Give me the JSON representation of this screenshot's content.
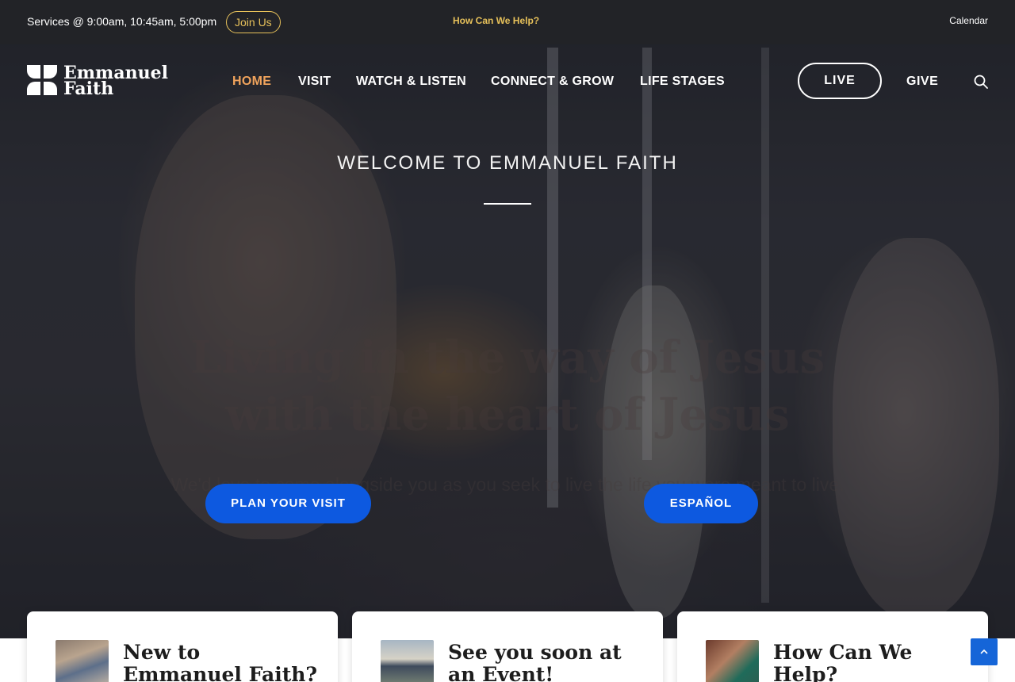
{
  "topbar": {
    "services": "Services @ 9:00am, 10:45am, 5:00pm",
    "join_label": "Join Us",
    "help_label": "How Can We Help?",
    "calendar_label": "Calendar",
    "accent_color": "#e7c15a"
  },
  "logo": {
    "line1": "Emmanuel",
    "line2": "Faith"
  },
  "nav": {
    "items": [
      {
        "label": "HOME",
        "active": true
      },
      {
        "label": "VISIT"
      },
      {
        "label": "WATCH & LISTEN"
      },
      {
        "label": "CONNECT & GROW"
      },
      {
        "label": "LIFE STAGES"
      }
    ],
    "live_label": "LIVE",
    "give_label": "GIVE",
    "search_icon": "search-icon",
    "active_color": "#f0a35c"
  },
  "hero": {
    "welcome": "WELCOME TO EMMANUEL FAITH",
    "headline_line1": "Living in the way of Jesus",
    "headline_line2": "with the heart of Jesus",
    "subline": "We'd love to come alongside you as you seek to live the life you were meant to live.",
    "plan_label": "PLAN YOUR VISIT",
    "espanol_label": "ESPAÑOL",
    "button_color": "#0d59e0"
  },
  "cards": [
    {
      "title": "New to Emmanuel Faith? Start here!"
    },
    {
      "title": "See you soon at an Event!"
    },
    {
      "title": "How Can We Help?"
    }
  ],
  "scroll_top_icon": "chevron-up-icon"
}
